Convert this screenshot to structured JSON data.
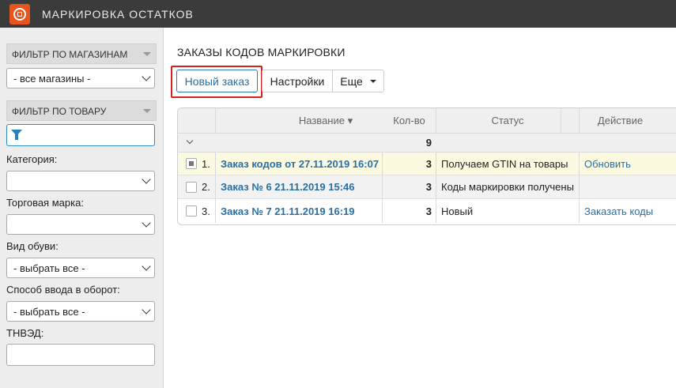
{
  "app": {
    "title": "МАРКИРОВКА ОСТАТКОВ"
  },
  "sidebar": {
    "store_filter": {
      "header": "ФИЛЬТР ПО МАГАЗИНАМ",
      "selected": "- все магазины -"
    },
    "product_filter": {
      "header": "ФИЛЬТР ПО ТОВАРУ",
      "search_value": ""
    },
    "category": {
      "label": "Категория:",
      "selected": ""
    },
    "brand": {
      "label": "Торговая марка:",
      "selected": ""
    },
    "shoe_type": {
      "label": "Вид обуви:",
      "selected": "- выбрать все -"
    },
    "circulation": {
      "label": "Способ ввода в оборот:",
      "selected": "- выбрать все -"
    },
    "tnved": {
      "label": "ТНВЭД:",
      "value": ""
    }
  },
  "main": {
    "title": "ЗАКАЗЫ КОДОВ МАРКИРОВКИ",
    "toolbar": {
      "new_order": "Новый заказ",
      "settings": "Настройки",
      "more": "Еще"
    },
    "table": {
      "columns": {
        "name": "Название ▾",
        "qty": "Кол-во",
        "status": "Статус",
        "action": "Действие"
      },
      "group_total": "9",
      "rows": [
        {
          "num": "1.",
          "name": "Заказ кодов от 27.11.2019 16:07",
          "qty": "3",
          "status": "Получаем GTIN на товары",
          "action": "Обновить"
        },
        {
          "num": "2.",
          "name": "Заказ № 6 21.11.2019 15:46",
          "qty": "3",
          "status": "Коды маркировки получены",
          "action": ""
        },
        {
          "num": "3.",
          "name": "Заказ № 7 21.11.2019 16:19",
          "qty": "3",
          "status": "Новый",
          "action": "Заказать коды"
        }
      ]
    }
  },
  "colors": {
    "accent": "#e8541e",
    "topbar": "#3b3b3b",
    "link": "#2a6fa3",
    "highlight": "#d62020"
  }
}
